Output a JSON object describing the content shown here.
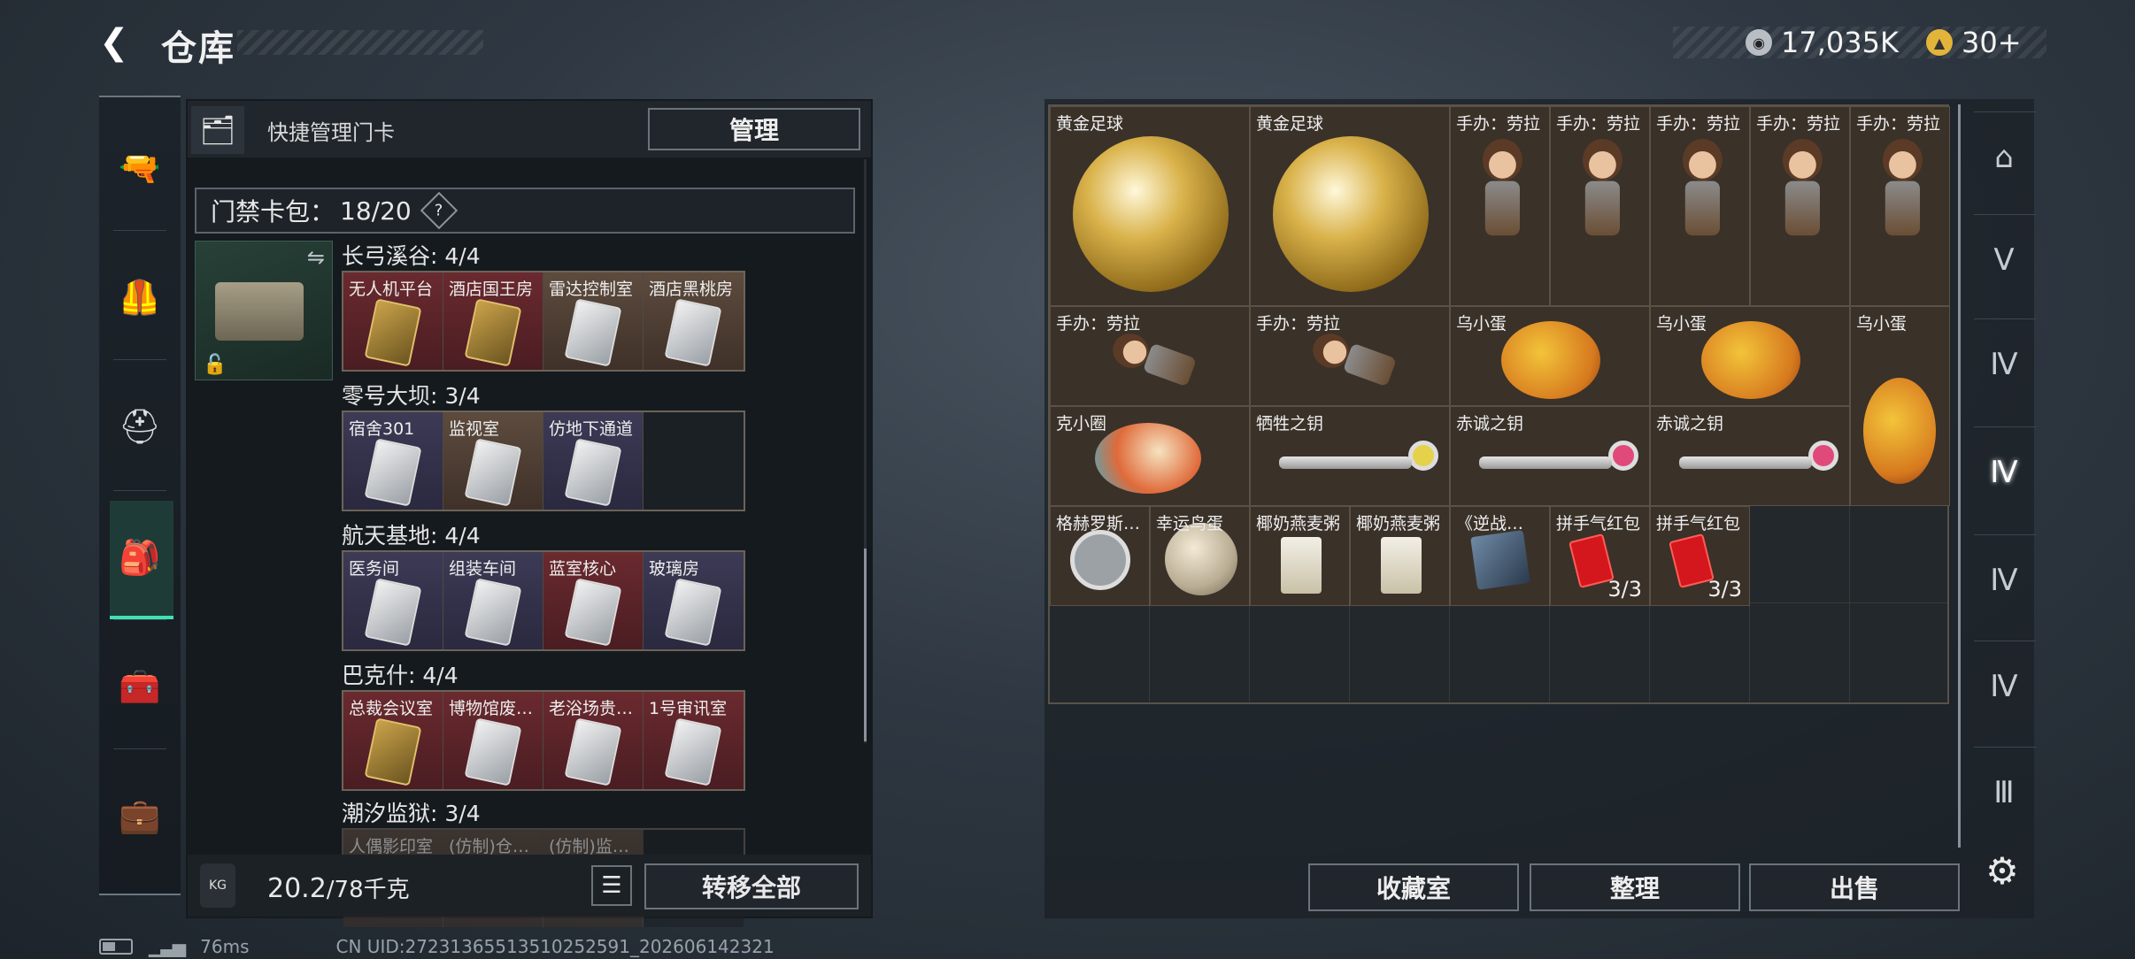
{
  "header": {
    "title": "仓库",
    "back_icon": "back-arrow-icon"
  },
  "currency": [
    {
      "name": "hafu-coin",
      "value": "17,035K",
      "icon": "coin-icon",
      "color": "#b9bec4"
    },
    {
      "name": "triangle-coin",
      "value": "30+",
      "icon": "triangle-coin-icon",
      "color": "#e2b43a"
    }
  ],
  "rail": [
    {
      "icon": "gun-icon",
      "glyph": "🔫"
    },
    {
      "icon": "armor-icon",
      "glyph": "🦺"
    },
    {
      "icon": "helmet-icon",
      "glyph": "⛑"
    },
    {
      "icon": "backpack-icon",
      "glyph": "🎒",
      "active": true
    },
    {
      "icon": "chest-rig-icon",
      "glyph": "🧰"
    },
    {
      "icon": "case-icon",
      "glyph": "💼"
    }
  ],
  "left_panel": {
    "quick_label": "快捷管理门卡",
    "manage_label": "管理",
    "card_pack_label": "门禁卡包：",
    "card_pack_value": "18/20",
    "help_label": "?",
    "groups": [
      {
        "title": "长弓溪谷: 4/4",
        "cards": [
          {
            "label": "无人机平台",
            "style": "red gold"
          },
          {
            "label": "酒店国王房",
            "style": "red gold"
          },
          {
            "label": "雷达控制室",
            "style": "brown silver"
          },
          {
            "label": "酒店黑桃房",
            "style": "brown silver"
          }
        ]
      },
      {
        "title": "零号大坝: 3/4",
        "cards": [
          {
            "label": "宿舍301",
            "style": "purple silver"
          },
          {
            "label": "监视室",
            "style": "brown silver"
          },
          {
            "label": "仿地下通道",
            "style": "purple silver"
          },
          {
            "label": "",
            "style": "empty"
          }
        ]
      },
      {
        "title": "航天基地: 4/4",
        "cards": [
          {
            "label": "医务间",
            "style": "purple silver"
          },
          {
            "label": "组装车间",
            "style": "purple silver"
          },
          {
            "label": "蓝室核心",
            "style": "red silver"
          },
          {
            "label": "玻璃房",
            "style": "purple silver"
          }
        ]
      },
      {
        "title": "巴克什: 4/4",
        "cards": [
          {
            "label": "总裁会议室",
            "style": "red gold"
          },
          {
            "label": "博物馆废…",
            "style": "red silver"
          },
          {
            "label": "老浴场贵…",
            "style": "red silver"
          },
          {
            "label": "1号审讯室",
            "style": "red silver"
          }
        ]
      },
      {
        "title": "潮汐监狱: 3/4",
        "cards": [
          {
            "label": "人偶影印室",
            "style": "brown"
          },
          {
            "label": "(仿制)仓…",
            "style": "brown"
          },
          {
            "label": "(仿制)监…",
            "style": "brown"
          },
          {
            "label": "",
            "style": "empty"
          }
        ]
      }
    ],
    "weight_value": "20.2",
    "weight_unit": "/78千克",
    "transfer_label": "转移全部",
    "kg_label": "KG"
  },
  "stash": {
    "items": [
      {
        "name": "黄金足球",
        "kind": "ball"
      },
      {
        "name": "黄金足球",
        "kind": "ball"
      },
      {
        "name": "手办：劳拉",
        "kind": "fig"
      },
      {
        "name": "手办：劳拉",
        "kind": "fig"
      },
      {
        "name": "手办：劳拉",
        "kind": "fig"
      },
      {
        "name": "手办：劳拉",
        "kind": "fig"
      },
      {
        "name": "手办：劳拉",
        "kind": "fig"
      },
      {
        "name": "手办：劳拉",
        "kind": "figlie"
      },
      {
        "name": "手办：劳拉",
        "kind": "figlie"
      },
      {
        "name": "乌小蛋",
        "kind": "egg"
      },
      {
        "name": "乌小蛋",
        "kind": "egg"
      },
      {
        "name": "乌小蛋",
        "kind": "eggtall"
      },
      {
        "name": "克小圈",
        "kind": "doll"
      },
      {
        "name": "牺牲之钥",
        "kind": "key",
        "gem": "#e6d24a"
      },
      {
        "name": "赤诚之钥",
        "kind": "key",
        "gem": "#e04a7a"
      },
      {
        "name": "赤诚之钥",
        "kind": "key",
        "gem": "#e04a7a"
      },
      {
        "name": "格赫罗斯…",
        "kind": "coin"
      },
      {
        "name": "幸运鸟蛋",
        "kind": "quail"
      },
      {
        "name": "椰奶燕麦粥",
        "kind": "pack"
      },
      {
        "name": "椰奶燕麦粥",
        "kind": "pack"
      },
      {
        "name": "《逆战…",
        "kind": "book"
      },
      {
        "name": "拼手气红包",
        "kind": "red",
        "qty": "3/3"
      },
      {
        "name": "拼手气红包",
        "kind": "red",
        "qty": "3/3"
      }
    ],
    "buttons": {
      "collection": "收藏室",
      "sort": "整理",
      "sell": "出售"
    }
  },
  "side_tabs": [
    {
      "icon": "stash-home-icon",
      "glyph": "⌂"
    },
    {
      "icon": "stash-v-icon",
      "glyph": "Ⅴ"
    },
    {
      "icon": "stash-iv-a-icon",
      "glyph": "Ⅳ"
    },
    {
      "icon": "stash-iv-b-icon",
      "glyph": "Ⅳ",
      "active": true
    },
    {
      "icon": "stash-iv-c-icon",
      "glyph": "Ⅳ"
    },
    {
      "icon": "stash-iv-d-icon",
      "glyph": "Ⅳ"
    },
    {
      "icon": "stash-iii-icon",
      "glyph": "Ⅲ"
    }
  ],
  "status": {
    "latency": "76ms",
    "uid": "CN UID:27231365513510252591_202606142321"
  }
}
